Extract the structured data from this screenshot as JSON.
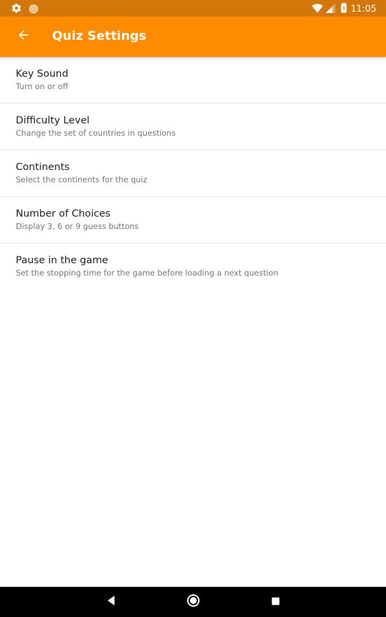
{
  "status_bar": {
    "time": "11:05",
    "left_icons": [
      "settings-gear-icon",
      "notification-dot-icon"
    ],
    "right_icons": [
      "wifi-icon",
      "cell-signal-icon",
      "battery-icon"
    ],
    "color": "#d4770a"
  },
  "app_bar": {
    "title": "Quiz Settings",
    "back_icon": "arrow-back-icon",
    "color": "#ff8c00"
  },
  "settings": [
    {
      "title": "Key Sound",
      "summary": "Turn on or off"
    },
    {
      "title": "Difficulty Level",
      "summary": "Change the set of countries in questions"
    },
    {
      "title": "Continents",
      "summary": "Select the continents for the quiz"
    },
    {
      "title": "Number of Choices",
      "summary": "Display 3, 6 or 9 guess buttons"
    },
    {
      "title": "Pause in the game",
      "summary": "Set the stopping time for the game before loading a next question"
    }
  ],
  "nav_bar": {
    "buttons": [
      "back-triangle-icon",
      "home-circle-icon",
      "recents-square-icon"
    ]
  }
}
